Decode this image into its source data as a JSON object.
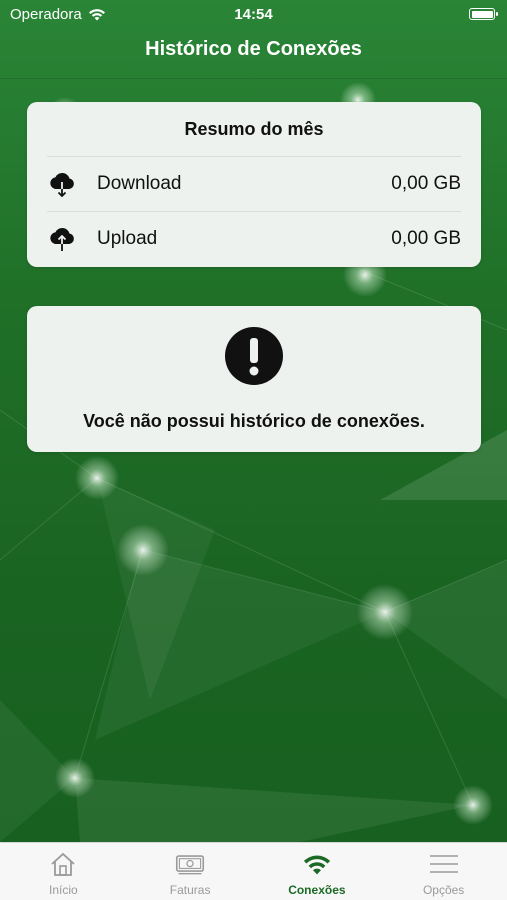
{
  "status_bar": {
    "carrier": "Operadora",
    "time": "14:54"
  },
  "nav": {
    "title": "Histórico de Conexões"
  },
  "summary": {
    "title": "Resumo do mês",
    "rows": [
      {
        "label": "Download",
        "value": "0,00 GB",
        "icon": "cloud-download-icon"
      },
      {
        "label": "Upload",
        "value": "0,00 GB",
        "icon": "cloud-upload-icon"
      }
    ]
  },
  "empty_state": {
    "message": "Você não possui histórico de conexões.",
    "icon": "exclamation-icon"
  },
  "tabs": [
    {
      "label": "Início",
      "icon": "home-icon",
      "active": false
    },
    {
      "label": "Faturas",
      "icon": "bill-icon",
      "active": false
    },
    {
      "label": "Conexões",
      "icon": "wifi-icon",
      "active": true
    },
    {
      "label": "Opções",
      "icon": "menu-icon",
      "active": false
    }
  ],
  "colors": {
    "brand_green": "#1c6a25",
    "inactive_gray": "#9a9a9a"
  }
}
